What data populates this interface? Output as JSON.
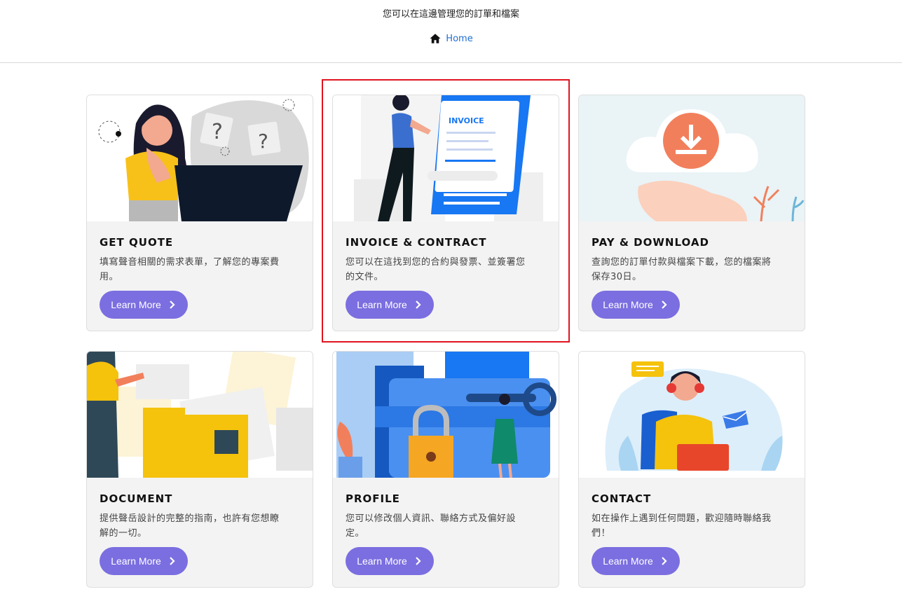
{
  "header": {
    "subtitle": "您可以在這邊管理您的訂單和檔案",
    "breadcrumb": {
      "icon": "home-icon",
      "label": "Home"
    }
  },
  "cards": [
    {
      "title": "GET QUOTE",
      "desc": "填寫聲音相關的需求表單，了解您的專案費用。",
      "button": "Learn More"
    },
    {
      "title": "INVOICE & CONTRACT",
      "desc": "您可以在這找到您的合約與發票、並簽署您的文件。",
      "button": "Learn More"
    },
    {
      "title": "PAY & DOWNLOAD",
      "desc": "查詢您的訂單付款與檔案下載，您的檔案將保存30日。",
      "button": "Learn More"
    },
    {
      "title": "DOCUMENT",
      "desc": "提供聲岳設計的完整的指南，也許有您想瞭解的一切。",
      "button": "Learn More"
    },
    {
      "title": "PROFILE",
      "desc": "您可以修改個人資訊、聯絡方式及偏好設定。",
      "button": "Learn More"
    },
    {
      "title": "CONTACT",
      "desc": "如在操作上遇到任何問題，歡迎隨時聯絡我們！",
      "button": "Learn More"
    }
  ],
  "illustrations": {
    "invoice_label": "INVOICE",
    "dollar": "$",
    "question": "?"
  },
  "colors": {
    "accent": "#7b6ee0",
    "link": "#1e6fd0",
    "highlight": "#e0141e"
  }
}
